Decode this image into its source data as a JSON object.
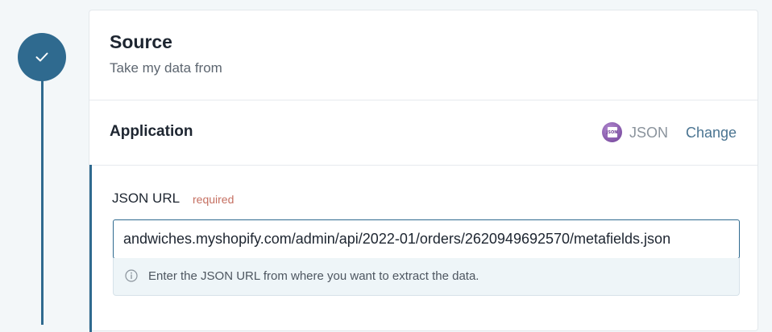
{
  "section": {
    "title": "Source",
    "subtitle": "Take my data from"
  },
  "application": {
    "label": "Application",
    "app_name": "JSON",
    "app_icon": "json-file-icon",
    "icon_text": "JSON",
    "change_label": "Change"
  },
  "field": {
    "label": "JSON URL",
    "required_label": "required",
    "value": "andwiches.myshopify.com/admin/api/2022-01/orders/2620949692570/metafields.json",
    "hint": "Enter the JSON URL from where you want to extract the data."
  },
  "colors": {
    "accent": "#2f6a8f",
    "required": "#c56f61",
    "link": "#4a7491",
    "app_icon": "#6d3d94"
  }
}
